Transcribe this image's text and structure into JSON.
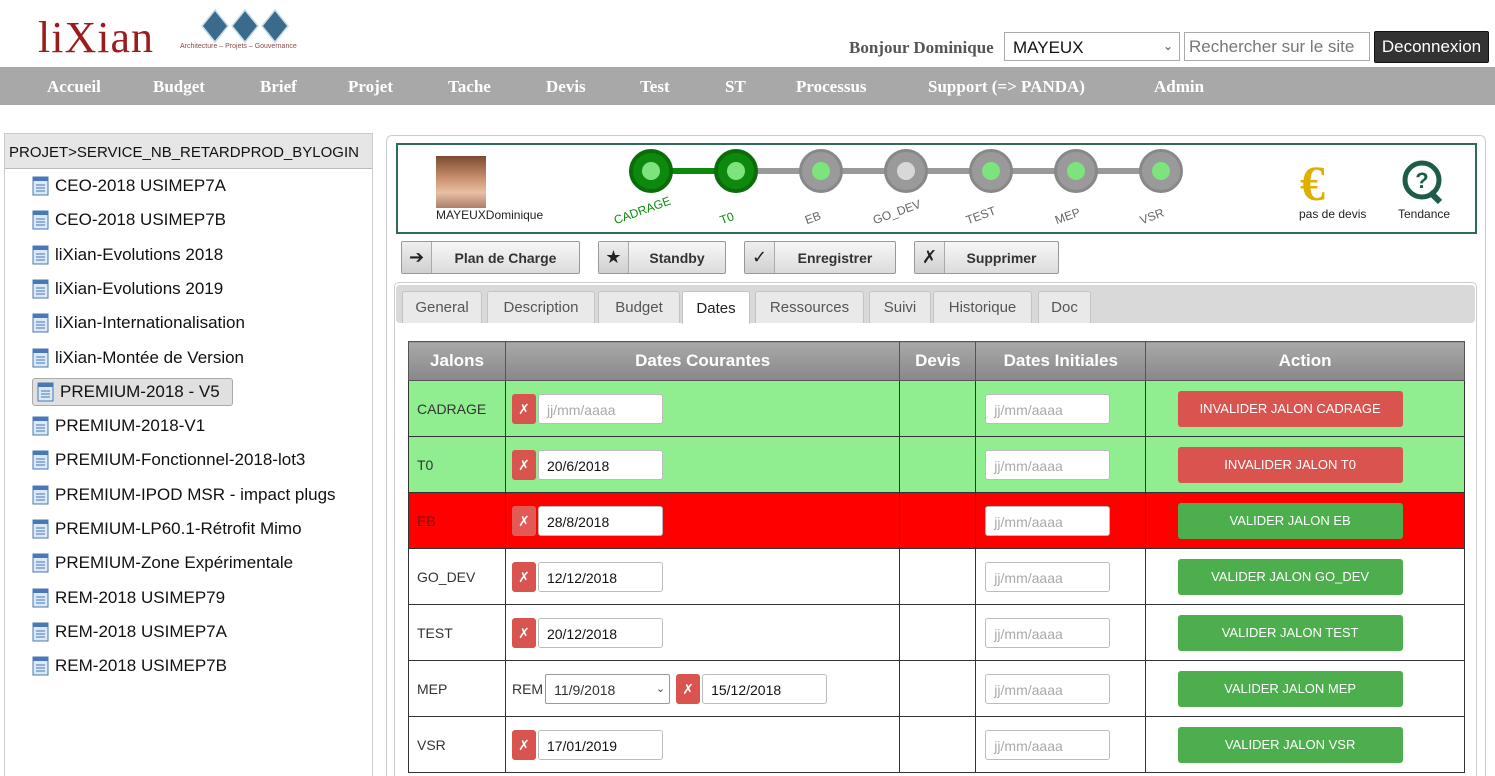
{
  "header": {
    "logo_text": "liXian",
    "logo_tagline": "Architecture – Projets – Gouvernance",
    "greeting": "Bonjour Dominique",
    "user_select_value": "MAYEUX",
    "search_placeholder": "Rechercher sur le site",
    "logout_label": "Deconnexion"
  },
  "nav": [
    "Accueil",
    "Budget",
    "Brief",
    "Projet",
    "Tache",
    "Devis",
    "Test",
    "ST",
    "Processus",
    "Support (=> PANDA)",
    "Admin"
  ],
  "sidebar": {
    "breadcrumb": "PROJET>SERVICE_NB_RETARDPROD_BYLOGIN",
    "items": [
      {
        "label": "CEO-2018 USIMEP7A"
      },
      {
        "label": "CEO-2018 USIMEP7B"
      },
      {
        "label": "liXian-Evolutions 2018"
      },
      {
        "label": "liXian-Evolutions 2019"
      },
      {
        "label": "liXian-Internationalisation"
      },
      {
        "label": "liXian-Montée de Version"
      },
      {
        "label": "PREMIUM-2018 - V5",
        "selected": true
      },
      {
        "label": "PREMIUM-2018-V1"
      },
      {
        "label": "PREMIUM-Fonctionnel-2018-lot3"
      },
      {
        "label": "PREMIUM-IPOD MSR - impact plugs"
      },
      {
        "label": "PREMIUM-LP60.1-Rétrofit Mimo"
      },
      {
        "label": "PREMIUM-Zone Expérimentale"
      },
      {
        "label": "REM-2018 USIMEP79"
      },
      {
        "label": "REM-2018 USIMEP7A"
      },
      {
        "label": "REM-2018 USIMEP7B"
      }
    ]
  },
  "milestones": {
    "user_name": "MAYEUXDominique",
    "nodes": [
      {
        "label": "CADRAGE",
        "state": "done"
      },
      {
        "label": "T0",
        "state": "done"
      },
      {
        "label": "EB",
        "state": "pending"
      },
      {
        "label": "GO_DEV",
        "state": "inactive"
      },
      {
        "label": "TEST",
        "state": "pending"
      },
      {
        "label": "MEP",
        "state": "pending"
      },
      {
        "label": "VSR",
        "state": "pending"
      }
    ],
    "devis_label": "pas de devis",
    "tendance_label": "Tendance"
  },
  "actions": {
    "plan_label": "Plan de Charge",
    "standby_label": "Standby",
    "save_label": "Enregistrer",
    "delete_label": "Supprimer"
  },
  "tabs": [
    "General",
    "Description",
    "Budget",
    "Dates",
    "Ressources",
    "Suivi",
    "Historique",
    "Doc"
  ],
  "active_tab": "Dates",
  "table": {
    "headers": [
      "Jalons",
      "Dates Courantes",
      "Devis",
      "Dates Initiales",
      "Action"
    ],
    "date_placeholder": "jj/mm/aaaa",
    "rem_label": "REM",
    "rows": [
      {
        "name": "CADRAGE",
        "current": "",
        "initial": "",
        "action": "INVALIDER JALON CADRAGE",
        "status": "green",
        "action_color": "red"
      },
      {
        "name": "T0",
        "current": "20/6/2018",
        "initial": "",
        "action": "INVALIDER JALON T0",
        "status": "green",
        "action_color": "red"
      },
      {
        "name": "EB",
        "current": "28/8/2018",
        "initial": "",
        "action": "VALIDER JALON EB",
        "status": "red",
        "action_color": "green"
      },
      {
        "name": "GO_DEV",
        "current": "12/12/2018",
        "initial": "",
        "action": "VALIDER JALON GO_DEV",
        "status": "white",
        "action_color": "green"
      },
      {
        "name": "TEST",
        "current": "20/12/2018",
        "initial": "",
        "action": "VALIDER JALON TEST",
        "status": "white",
        "action_color": "green"
      },
      {
        "name": "MEP",
        "rem_value": "11/9/2018",
        "current": "15/12/2018",
        "initial": "",
        "action": "VALIDER JALON MEP",
        "status": "white",
        "action_color": "green"
      },
      {
        "name": "VSR",
        "current": "17/01/2019",
        "initial": "",
        "action": "VALIDER JALON VSR",
        "status": "white",
        "action_color": "green"
      }
    ]
  }
}
